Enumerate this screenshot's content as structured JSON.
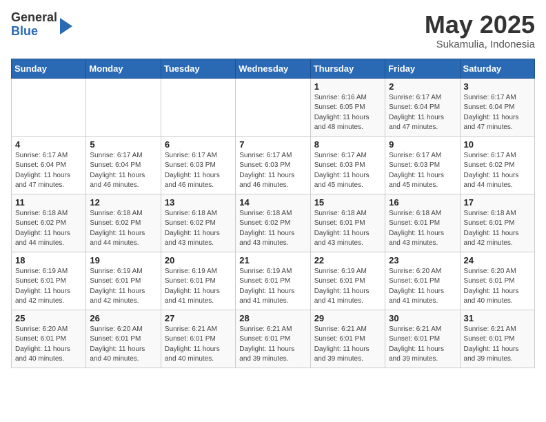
{
  "header": {
    "logo_general": "General",
    "logo_blue": "Blue",
    "month_title": "May 2025",
    "location": "Sukamulia, Indonesia"
  },
  "weekdays": [
    "Sunday",
    "Monday",
    "Tuesday",
    "Wednesday",
    "Thursday",
    "Friday",
    "Saturday"
  ],
  "weeks": [
    [
      {
        "day": "",
        "info": ""
      },
      {
        "day": "",
        "info": ""
      },
      {
        "day": "",
        "info": ""
      },
      {
        "day": "",
        "info": ""
      },
      {
        "day": "1",
        "info": "Sunrise: 6:16 AM\nSunset: 6:05 PM\nDaylight: 11 hours\nand 48 minutes."
      },
      {
        "day": "2",
        "info": "Sunrise: 6:17 AM\nSunset: 6:04 PM\nDaylight: 11 hours\nand 47 minutes."
      },
      {
        "day": "3",
        "info": "Sunrise: 6:17 AM\nSunset: 6:04 PM\nDaylight: 11 hours\nand 47 minutes."
      }
    ],
    [
      {
        "day": "4",
        "info": "Sunrise: 6:17 AM\nSunset: 6:04 PM\nDaylight: 11 hours\nand 47 minutes."
      },
      {
        "day": "5",
        "info": "Sunrise: 6:17 AM\nSunset: 6:04 PM\nDaylight: 11 hours\nand 46 minutes."
      },
      {
        "day": "6",
        "info": "Sunrise: 6:17 AM\nSunset: 6:03 PM\nDaylight: 11 hours\nand 46 minutes."
      },
      {
        "day": "7",
        "info": "Sunrise: 6:17 AM\nSunset: 6:03 PM\nDaylight: 11 hours\nand 46 minutes."
      },
      {
        "day": "8",
        "info": "Sunrise: 6:17 AM\nSunset: 6:03 PM\nDaylight: 11 hours\nand 45 minutes."
      },
      {
        "day": "9",
        "info": "Sunrise: 6:17 AM\nSunset: 6:03 PM\nDaylight: 11 hours\nand 45 minutes."
      },
      {
        "day": "10",
        "info": "Sunrise: 6:17 AM\nSunset: 6:02 PM\nDaylight: 11 hours\nand 44 minutes."
      }
    ],
    [
      {
        "day": "11",
        "info": "Sunrise: 6:18 AM\nSunset: 6:02 PM\nDaylight: 11 hours\nand 44 minutes."
      },
      {
        "day": "12",
        "info": "Sunrise: 6:18 AM\nSunset: 6:02 PM\nDaylight: 11 hours\nand 44 minutes."
      },
      {
        "day": "13",
        "info": "Sunrise: 6:18 AM\nSunset: 6:02 PM\nDaylight: 11 hours\nand 43 minutes."
      },
      {
        "day": "14",
        "info": "Sunrise: 6:18 AM\nSunset: 6:02 PM\nDaylight: 11 hours\nand 43 minutes."
      },
      {
        "day": "15",
        "info": "Sunrise: 6:18 AM\nSunset: 6:01 PM\nDaylight: 11 hours\nand 43 minutes."
      },
      {
        "day": "16",
        "info": "Sunrise: 6:18 AM\nSunset: 6:01 PM\nDaylight: 11 hours\nand 43 minutes."
      },
      {
        "day": "17",
        "info": "Sunrise: 6:18 AM\nSunset: 6:01 PM\nDaylight: 11 hours\nand 42 minutes."
      }
    ],
    [
      {
        "day": "18",
        "info": "Sunrise: 6:19 AM\nSunset: 6:01 PM\nDaylight: 11 hours\nand 42 minutes."
      },
      {
        "day": "19",
        "info": "Sunrise: 6:19 AM\nSunset: 6:01 PM\nDaylight: 11 hours\nand 42 minutes."
      },
      {
        "day": "20",
        "info": "Sunrise: 6:19 AM\nSunset: 6:01 PM\nDaylight: 11 hours\nand 41 minutes."
      },
      {
        "day": "21",
        "info": "Sunrise: 6:19 AM\nSunset: 6:01 PM\nDaylight: 11 hours\nand 41 minutes."
      },
      {
        "day": "22",
        "info": "Sunrise: 6:19 AM\nSunset: 6:01 PM\nDaylight: 11 hours\nand 41 minutes."
      },
      {
        "day": "23",
        "info": "Sunrise: 6:20 AM\nSunset: 6:01 PM\nDaylight: 11 hours\nand 41 minutes."
      },
      {
        "day": "24",
        "info": "Sunrise: 6:20 AM\nSunset: 6:01 PM\nDaylight: 11 hours\nand 40 minutes."
      }
    ],
    [
      {
        "day": "25",
        "info": "Sunrise: 6:20 AM\nSunset: 6:01 PM\nDaylight: 11 hours\nand 40 minutes."
      },
      {
        "day": "26",
        "info": "Sunrise: 6:20 AM\nSunset: 6:01 PM\nDaylight: 11 hours\nand 40 minutes."
      },
      {
        "day": "27",
        "info": "Sunrise: 6:21 AM\nSunset: 6:01 PM\nDaylight: 11 hours\nand 40 minutes."
      },
      {
        "day": "28",
        "info": "Sunrise: 6:21 AM\nSunset: 6:01 PM\nDaylight: 11 hours\nand 39 minutes."
      },
      {
        "day": "29",
        "info": "Sunrise: 6:21 AM\nSunset: 6:01 PM\nDaylight: 11 hours\nand 39 minutes."
      },
      {
        "day": "30",
        "info": "Sunrise: 6:21 AM\nSunset: 6:01 PM\nDaylight: 11 hours\nand 39 minutes."
      },
      {
        "day": "31",
        "info": "Sunrise: 6:21 AM\nSunset: 6:01 PM\nDaylight: 11 hours\nand 39 minutes."
      }
    ]
  ]
}
